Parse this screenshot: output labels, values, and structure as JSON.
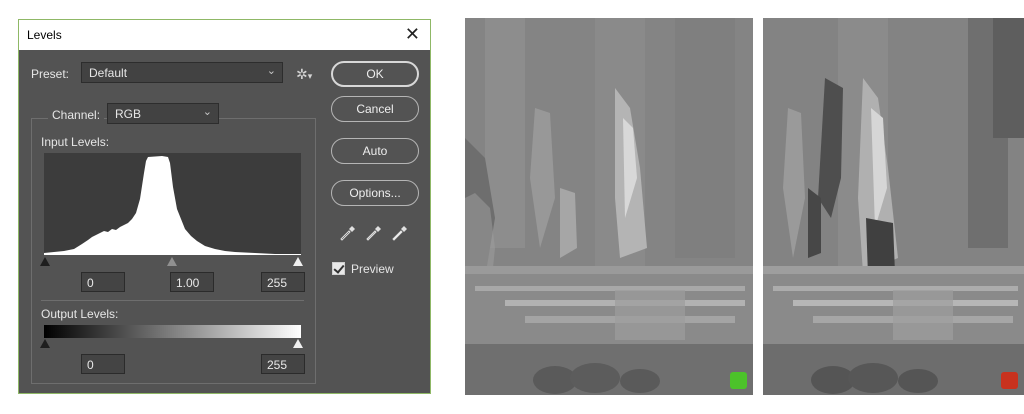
{
  "dialog": {
    "title": "Levels",
    "preset_label": "Preset:",
    "preset_value": "Default",
    "channel_label": "Channel:",
    "channel_value": "RGB",
    "input_levels_label": "Input Levels:",
    "input_black": "0",
    "input_gamma": "1.00",
    "input_white": "255",
    "output_levels_label": "Output Levels:",
    "output_black": "0",
    "output_white": "255",
    "buttons": {
      "ok": "OK",
      "cancel": "Cancel",
      "auto": "Auto",
      "options": "Options..."
    },
    "preview_label": "Preview",
    "preview_checked": true
  },
  "icons": {
    "close": "close-icon",
    "chevron": "chevron-down-icon",
    "gear": "gear-icon",
    "droppers": [
      "black-point-eyedropper-icon",
      "gray-point-eyedropper-icon",
      "white-point-eyedropper-icon"
    ]
  },
  "colors": {
    "dialog_bg": "#535353",
    "dialog_border": "#8fb866",
    "before_swatch": "#4cc22a",
    "after_swatch": "#c8321e"
  }
}
